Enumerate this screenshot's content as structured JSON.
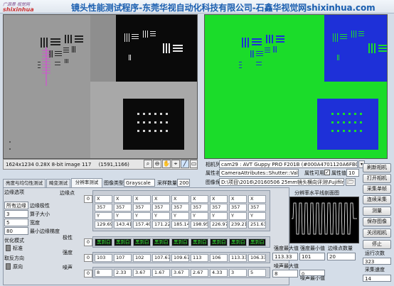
{
  "logo": {
    "top": "广源景 视觉网",
    "bottom": "shixinhua"
  },
  "title": "镜头性能测试程序-东莞华视自动化科技有限公司-石鑫华视觉网shixinhua.com",
  "status_bar": {
    "info": "1624x1234 0.28X 8-bit image 117",
    "coords": "(1591,1166)"
  },
  "camera": {
    "list_label": "相机列表",
    "list_value": "cam29 : AVT Guppy PRO F201B (#000A4701120A6FB0).icd",
    "attr_name_label": "属性名称",
    "attr_name_value": "CameraAttributes::Shutter::Value",
    "attr_avail_label": "属性可用",
    "attr_value_label": "属性值",
    "attr_value": "10",
    "save_path_label": "图像保存",
    "save_path_value": "D:\\项目\\2016\\20160506 25mm镜头横向评测\\Fujifilm\\分析图"
  },
  "right_buttons": [
    "刷新相机",
    "打开相机",
    "采集单帧",
    "连续采集",
    "测量",
    "保存图像",
    "关闭相机",
    "停止"
  ],
  "run_count": {
    "label": "运行次数",
    "value": "323"
  },
  "capture_speed": {
    "label": "采集速度",
    "value": "14"
  },
  "tabs": [
    "亮度与均匀性测试",
    "畸变测试",
    "分辨率测试",
    "图像类型",
    "采样数量"
  ],
  "image_type": "Grayscale",
  "sample_count": "200",
  "edge_options": {
    "title": "边缘选项",
    "polarity_label": "边缘极性",
    "polarity_value": "所有边缘",
    "kernel_label": "算子大小",
    "kernel_value": "3",
    "width_label": "宽度",
    "width_value": "5",
    "min_strength_label": "最小边缘梯度",
    "min_strength_value": "80",
    "optimize_label": "优化模式",
    "optimize_value": "标准",
    "sort_label": "取反方向",
    "sort_value": "原向"
  },
  "edges": {
    "label": "边缘点",
    "index": "0",
    "x_headers": [
      "X",
      "X",
      "X",
      "X",
      "X",
      "X",
      "X",
      "X",
      "X"
    ],
    "x_vals": [
      "357",
      "357",
      "357",
      "357",
      "357",
      "357",
      "357",
      "357",
      "357"
    ],
    "y_headers": [
      "Y",
      "Y",
      "Y",
      "Y",
      "Y",
      "Y",
      "Y",
      "Y",
      "Y"
    ],
    "y_vals": [
      "129.69",
      "143.41",
      "157.40",
      "171.22",
      "185.14",
      "198.95",
      "226.97",
      "239.21",
      "251.63"
    ]
  },
  "polarity": {
    "label": "极性",
    "index": "0",
    "values": [
      "黑到白",
      "黑到白",
      "黑到白",
      "黑到白",
      "黑到白",
      "黑到白",
      "黑到白",
      "黑到白",
      "黑到白"
    ]
  },
  "strength": {
    "label": "强度",
    "index": "0",
    "values": [
      "103",
      "107",
      "102",
      "107.67",
      "109.67",
      "113",
      "106",
      "113.33",
      "106.33"
    ]
  },
  "noise": {
    "label": "噪声",
    "index": "0",
    "values": [
      "8",
      "2.33",
      "3.67",
      "1.67",
      "3.67",
      "2.67",
      "4.33",
      "3",
      "5"
    ]
  },
  "profile": {
    "title": "分辨率水平线剖面图"
  },
  "stats": {
    "max_strength_label": "强度最大值",
    "max_strength_value": "113.33",
    "min_strength_label": "强度最小值",
    "min_strength_value": "101",
    "edge_count_label": "边缘点数量",
    "edge_count_value": "20",
    "max_noise_label": "噪声最大值",
    "max_noise_value": "8",
    "min_noise_label": "噪声最小值",
    "min_noise_value": "0"
  },
  "colors": {
    "accent": "#1b5fb0",
    "overlay_green": "#1bdc2a",
    "overlay_blue": "#1e30d8"
  }
}
